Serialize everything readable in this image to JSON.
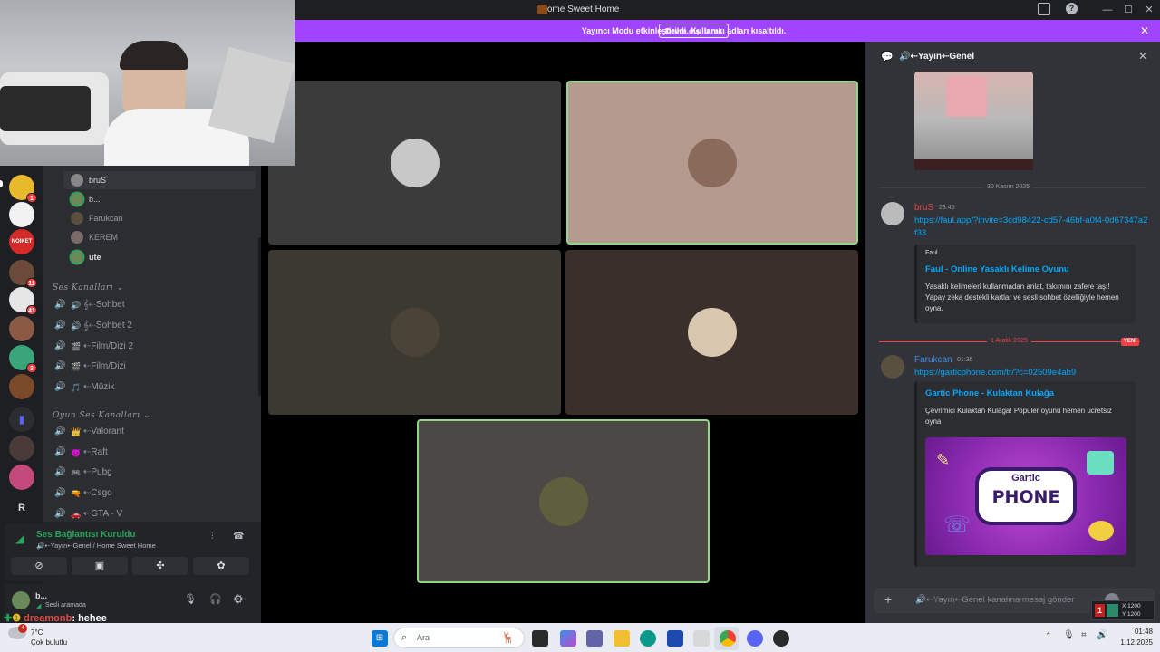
{
  "window": {
    "title": "Home Sweet Home",
    "controls": [
      "—",
      "☐",
      "✕"
    ]
  },
  "banner": {
    "text": "Yayıncı Modu etkinleştirildi. Kullanıcı adları kısaltıldı.",
    "button": "Devre dışı bırak",
    "bg": "#a044ff"
  },
  "servers": [
    {
      "color": "#e8b92b",
      "badge": "1"
    },
    {
      "color": "#f2f2f2",
      "badge": ""
    },
    {
      "color": "#d42a2a",
      "label": "NOIKET",
      "badge": ""
    },
    {
      "color": "#6b4a3a",
      "badge": "11"
    },
    {
      "color": "#e6e6e6",
      "badge": "41"
    },
    {
      "color": "#8a5a44",
      "badge": ""
    },
    {
      "color": "#3aa57a",
      "badge": "3"
    },
    {
      "color": "#7a4a2a",
      "badge": ""
    },
    {
      "color": "#5865f2",
      "badge": ""
    },
    {
      "color": "#4a3a3a",
      "badge": ""
    },
    {
      "color": "#c34a7a",
      "badge": ""
    },
    {
      "color": "#2b2d31",
      "label": "R",
      "badge": ""
    }
  ],
  "voice_members": [
    {
      "name": "bruS",
      "color": "#888"
    },
    {
      "name": "b...",
      "color": "#6a8a5a"
    },
    {
      "name": "Farukcan",
      "color": "#5a5040"
    },
    {
      "name": "KEREM",
      "color": "#7a6a6a"
    },
    {
      "name": "ute",
      "color": "#6a8a5a"
    }
  ],
  "categories": {
    "voice": "Ses Kanalları",
    "game": "Oyun Ses Kanalları"
  },
  "voice_channels": [
    {
      "icon": "🔊",
      "name": "𝄞⇠Sohbet"
    },
    {
      "icon": "🔊",
      "name": "𝄞⇠Sohbet 2"
    },
    {
      "icon": "🎬",
      "name": "⇠Film/Dizi 2"
    },
    {
      "icon": "🎬",
      "name": "⇠Film/Dizi"
    },
    {
      "icon": "🎵",
      "name": "⇠Müzik"
    }
  ],
  "game_channels": [
    {
      "icon": "👑",
      "name": "⇠Valorant"
    },
    {
      "icon": "😈",
      "name": "⇠Raft"
    },
    {
      "icon": "🎮",
      "name": "⇠Pubg"
    },
    {
      "icon": "🔫",
      "name": "⇠Csgo"
    },
    {
      "icon": "🚗",
      "name": "⇠GTA - V"
    }
  ],
  "voice_panel": {
    "status": "Ses Bağlantısı Kuruldu",
    "location": "🔊⇠Yayın⇠Genel / Home Sweet Home"
  },
  "user_panel": {
    "name": "b...",
    "status": "Sesli aramada"
  },
  "overlay_msg": {
    "user": "dreamonb",
    "text": ": hehee"
  },
  "tiles": [
    {
      "bg": "#3b3b3b",
      "av": "#c8c8c8"
    },
    {
      "bg": "#b59a8e",
      "av": "#8a6a5a"
    },
    {
      "bg": "#3c3a30",
      "av": "#4a4438"
    },
    {
      "bg": "#3b2f2b",
      "av": "#d8c8b0"
    },
    {
      "bg": "#4c4845",
      "av": "#6a6a3a"
    }
  ],
  "chat": {
    "channel": "🔊⇠Yayın⇠Genel",
    "date1": "30 Kasım 2025",
    "msg1": {
      "user": "bruS",
      "time": "23:45",
      "link": "https://faul.app/?invite=3cd98422-cd57-46bf-a0f4-0d67347a2f33",
      "embed": {
        "site": "Faul",
        "title": "Faul - Online Yasaklı Kelime Oyunu",
        "desc": "Yasaklı kelimeleri kullanmadan anlat, takımını zafere taşı! Yapay zeka destekli kartlar ve sesli sohbet özelliğiyle hemen oyna."
      }
    },
    "date2": "1 Aralık 2025",
    "new": "YENİ",
    "msg2": {
      "user": "Farukcan",
      "time": "01:35",
      "link": "https://garticphone.com/tr/?c=02509e4ab9",
      "embed": {
        "title": "Gartic Phone - Kulaktan Kulağa",
        "desc": "Çevrimiçi Kulaktan Kulağa! Popüler oyunu hemen ücretsiz oyna",
        "image_top": "Gartic",
        "image_main": "PHONE"
      }
    },
    "placeholder": "🔊⇠Yayın⇠Genel kanalına mesaj gönder"
  },
  "stats": {
    "x": "X 1200",
    "y": "Y 1200"
  },
  "taskbar": {
    "weather_temp": "7°C",
    "weather_desc": "Çok bulutlu",
    "weather_badge": "4",
    "search": "Ara",
    "time": "01:48",
    "date": "1.12.2025"
  }
}
